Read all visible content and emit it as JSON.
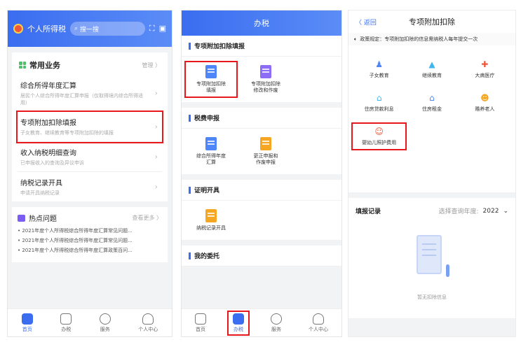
{
  "panel1": {
    "app_title": "个人所得税",
    "search_placeholder": "搜一搜",
    "common_section": {
      "title": "常用业务",
      "manage": "管理 〉"
    },
    "business": [
      {
        "title": "综合所得年度汇算",
        "desc": "居民个人综合所得年度汇算申报（仅取得境内综合所得适用）"
      },
      {
        "title": "专项附加扣除填报",
        "desc": "子女教育、继续教育等专项附加扣除的填报"
      },
      {
        "title": "收入纳税明细查询",
        "desc": "已申报收入的查询及异议申诉"
      },
      {
        "title": "纳税记录开具",
        "desc": "申请开具纳税记录"
      }
    ],
    "hot": {
      "title": "热点问题",
      "more": "查看更多 〉",
      "items": [
        "• 2021年度个人所得税综合所得年度汇算常见问题...",
        "• 2021年度个人所得税综合所得年度汇算常见问题...",
        "• 2021年度个人所得税综合所得年度汇算政策百问..."
      ]
    },
    "tabs": [
      "首页",
      "办税",
      "服务",
      "个人中心"
    ]
  },
  "panel2": {
    "header": "办税",
    "sections": [
      {
        "title": "专项附加扣除填报",
        "items": [
          "专项附加扣除\n填报",
          "专项附加扣除\n修改和作废"
        ]
      },
      {
        "title": "税费申报",
        "items": [
          "综合所得年度\n汇算",
          "更正申报和\n作废申报"
        ]
      },
      {
        "title": "证明开具",
        "items": [
          "纳税记录开具"
        ]
      },
      {
        "title": "我的委托",
        "items": []
      }
    ],
    "tabs": [
      "首页",
      "办税",
      "服务",
      "个人中心"
    ]
  },
  "panel3": {
    "back": "〈 返回",
    "title": "专项附加扣除",
    "notice": "政策规定：专项附加扣除的信息需纳税人每年提交一次",
    "items": [
      "子女教育",
      "继续教育",
      "大病医疗",
      "住房贷款利息",
      "住房租金",
      "赡养老人",
      "婴幼儿照护费用"
    ],
    "record_title": "填报记录",
    "year_label": "选择查询年度:",
    "year_value": "2022",
    "empty_text": "暂无扣除信息"
  },
  "colors": {
    "primary": "#3a6df0",
    "highlight": "#e8171c"
  }
}
